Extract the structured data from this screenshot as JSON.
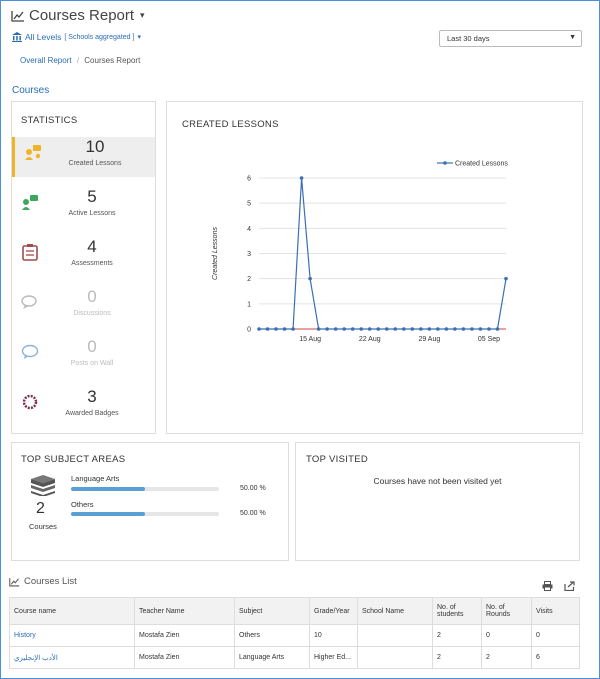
{
  "header": {
    "title": "Courses Report"
  },
  "levels": {
    "label": "All Levels",
    "sub": "[ Schools aggregated ]"
  },
  "date_filter": {
    "value": "Last 30 days"
  },
  "breadcrumb": {
    "home": "Overall Report",
    "separator": "/",
    "current": "Courses Report"
  },
  "section_title": "Courses",
  "statistics": {
    "title": "STATISTICS",
    "items": [
      {
        "value": "10",
        "label": "Created Lessons"
      },
      {
        "value": "5",
        "label": "Active Lessons"
      },
      {
        "value": "4",
        "label": "Assessments"
      },
      {
        "value": "0",
        "label": "Discussions"
      },
      {
        "value": "0",
        "label": "Posts on Wall"
      },
      {
        "value": "3",
        "label": "Awarded Badges"
      }
    ]
  },
  "chart_panel": {
    "title": "CREATED LESSONS"
  },
  "chart_data": {
    "type": "line",
    "ylabel": "Created Lessons",
    "legend": "top-right",
    "series": [
      {
        "name": "Created Lessons",
        "values": [
          0,
          0,
          0,
          0,
          0,
          6,
          2,
          0,
          0,
          0,
          0,
          0,
          0,
          0,
          0,
          0,
          0,
          0,
          0,
          0,
          0,
          0,
          0,
          0,
          0,
          0,
          0,
          0,
          0,
          2
        ]
      }
    ],
    "x_tick_labels": [
      "15 Aug",
      "22 Aug",
      "29 Aug",
      "05 Sep"
    ],
    "y_ticks": [
      "0",
      "1",
      "2",
      "3",
      "4",
      "5",
      "6"
    ],
    "ylim": [
      0,
      6
    ],
    "grid": true,
    "colors": {
      "line": "#3a6fb5"
    }
  },
  "subjects": {
    "title": "TOP SUBJECT AREAS",
    "count": "2",
    "count_label": "Courses",
    "items": [
      {
        "name": "Language Arts",
        "percent_text": "50.00 %",
        "fraction": 0.5
      },
      {
        "name": "Others",
        "percent_text": "50.00 %",
        "fraction": 0.5
      }
    ]
  },
  "visited": {
    "title": "TOP VISITED",
    "message": "Courses have not been visited yet"
  },
  "courses_list": {
    "title": "Courses List",
    "columns": [
      "Course name",
      "Teacher Name",
      "Subject",
      "Grade/Year",
      "School Name",
      "No. of students",
      "No. of Rounds",
      "Visits"
    ],
    "rows": [
      [
        "History",
        "Mostafa Zien",
        "Others",
        "10",
        "",
        "2",
        "0",
        "0"
      ],
      [
        "الأدب الإنجليزي",
        "Mostafa Zien",
        "Language Arts",
        "Higher Ed...",
        "",
        "2",
        "2",
        "6"
      ]
    ]
  }
}
